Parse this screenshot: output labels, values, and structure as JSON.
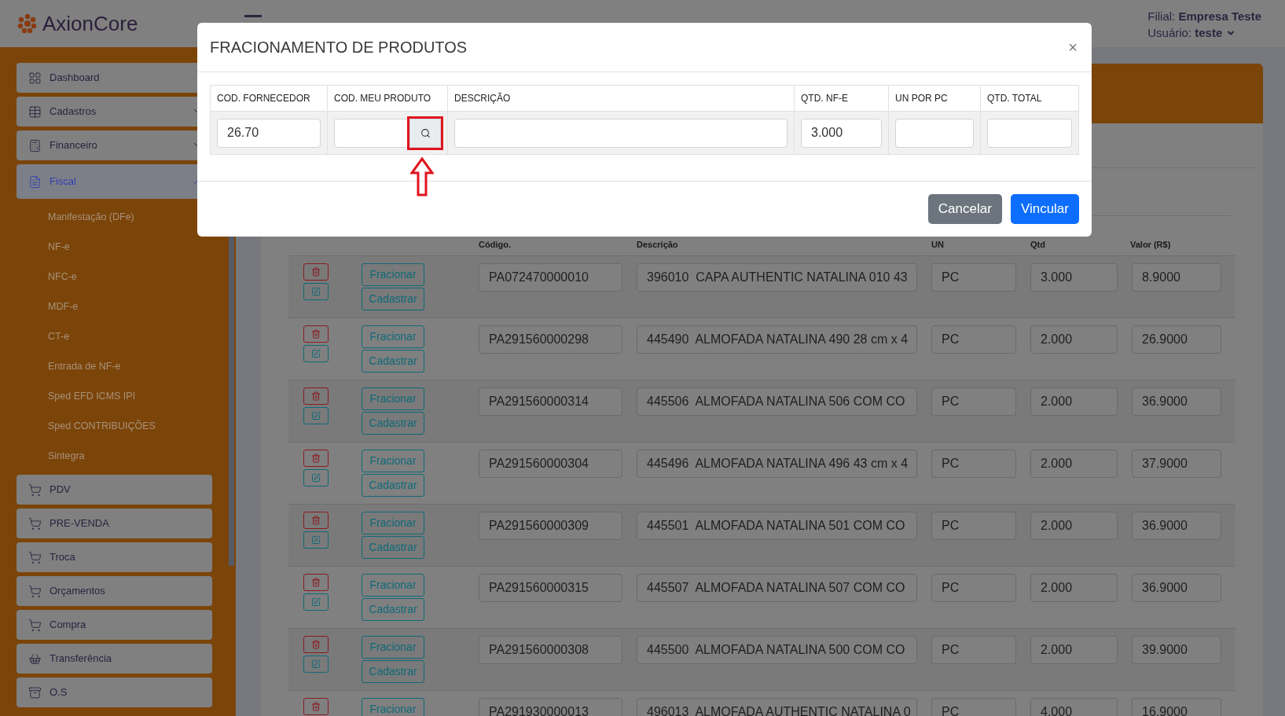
{
  "app": {
    "logo": "AxionCore"
  },
  "header": {
    "branch_label": "Filial:",
    "branch": "Empresa Teste",
    "user_label": "Usuário:",
    "user": "teste"
  },
  "sidebar": {
    "items": [
      {
        "label": "Dashboard",
        "selected": false
      },
      {
        "label": "Cadastros",
        "selected": false,
        "expanded": false
      },
      {
        "label": "Financeiro",
        "selected": false,
        "expanded": false
      },
      {
        "label": "Fiscal",
        "selected": true,
        "expanded": true,
        "children": [
          {
            "label": "Manifestação (DFe)"
          },
          {
            "label": "NF-e"
          },
          {
            "label": "NFC-e"
          },
          {
            "label": "MDF-e"
          },
          {
            "label": "CT-e"
          },
          {
            "label": "Entrada de NF-e"
          },
          {
            "label": "Sped EFD ICMS IPI"
          },
          {
            "label": "Sped CONTRIBUIÇÕES"
          },
          {
            "label": "Sintegra"
          }
        ]
      },
      {
        "label": "PDV",
        "selected": false
      },
      {
        "label": "PRE-VENDA",
        "selected": false
      },
      {
        "label": "Troca",
        "selected": false
      },
      {
        "label": "Orçamentos",
        "selected": false
      },
      {
        "label": "Compra",
        "selected": false
      },
      {
        "label": "Transferência",
        "selected": false
      },
      {
        "label": "O.S",
        "selected": false
      }
    ]
  },
  "table": {
    "columns": [
      "Código.",
      "Descrição",
      "UN",
      "Qtd",
      "Valor (R$)"
    ],
    "rows": [
      {
        "buttons": [
          "Fracionar",
          "Cadastrar"
        ],
        "edit": true,
        "code": "PA072470000010",
        "description": "396010  CAPA AUTHENTIC NATALINA 010 43",
        "un": "PC",
        "qty": "3.000",
        "value": "8.9000"
      },
      {
        "buttons": [
          "Fracionar",
          "Cadastrar"
        ],
        "edit": true,
        "code": "PA291560000298",
        "description": "445490  ALMOFADA NATALINA 490 28 cm x 4",
        "un": "PC",
        "qty": "2.000",
        "value": "26.9000"
      },
      {
        "buttons": [
          "Fracionar",
          "Cadastrar"
        ],
        "edit": true,
        "code": "PA291560000314",
        "description": "445506  ALMOFADA NATALINA 506 COM CO",
        "un": "PC",
        "qty": "2.000",
        "value": "36.9000"
      },
      {
        "buttons": [
          "Fracionar",
          "Cadastrar"
        ],
        "edit": true,
        "code": "PA291560000304",
        "description": "445496  ALMOFADA NATALINA 496 43 cm x 4",
        "un": "PC",
        "qty": "2.000",
        "value": "37.9000"
      },
      {
        "buttons": [
          "Fracionar",
          "Cadastrar"
        ],
        "edit": true,
        "code": "PA291560000309",
        "description": "445501  ALMOFADA NATALINA 501 COM CO",
        "un": "PC",
        "qty": "2.000",
        "value": "36.9000"
      },
      {
        "buttons": [
          "Fracionar",
          "Cadastrar"
        ],
        "edit": true,
        "code": "PA291560000315",
        "description": "445507  ALMOFADA NATALINA 507 COM CO",
        "un": "PC",
        "qty": "2.000",
        "value": "36.9000"
      },
      {
        "buttons": [
          "Fracionar",
          "Cadastrar"
        ],
        "edit": true,
        "code": "PA291560000308",
        "description": "445500  ALMOFADA NATALINA 500 COM CO",
        "un": "PC",
        "qty": "2.000",
        "value": "39.9000"
      },
      {
        "buttons": [
          "Fracionar"
        ],
        "edit": false,
        "code": "PA291930000013",
        "description": "496013  ALMOFADA AUTHENTIC NATALINA 0",
        "un": "PC",
        "qty": "4.000",
        "value": "16.9000"
      }
    ]
  },
  "modal": {
    "title": "FRACIONAMENTO DE PRODUTOS",
    "close": "×",
    "columns": [
      "COD. FORNECEDOR",
      "COD. MEU PRODUTO",
      "DESCRIÇÃO",
      "QTD. NF-E",
      "UN POR PC",
      "QTD. TOTAL"
    ],
    "fields": [
      {
        "kind": "text",
        "value": "26.70"
      },
      {
        "kind": "search"
      },
      {
        "kind": "text"
      },
      {
        "kind": "text",
        "value": "3.000"
      },
      {
        "kind": "text"
      },
      {
        "kind": "text"
      }
    ],
    "buttons": [
      {
        "kind": "secondary",
        "label": "Cancelar"
      },
      {
        "kind": "primary",
        "label": "Vincular"
      }
    ]
  }
}
